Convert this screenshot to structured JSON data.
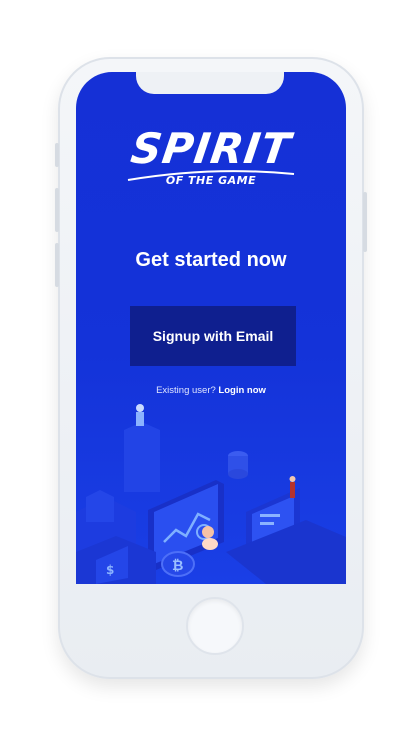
{
  "colors": {
    "screen_background": "#1433d9",
    "button_background": "#0f1f8f",
    "text": "#ffffff",
    "phone_body": "#eef1f5"
  },
  "logo": {
    "wordmark": "SPIRIT",
    "tagline": "OF THE GAME"
  },
  "main": {
    "headline": "Get started now",
    "signup_button_label": "Signup with Email",
    "existing_prompt": "Existing user?",
    "login_link": "Login now"
  },
  "icons": {
    "illustration": "isometric-finance-illustration-icon",
    "home_button": "home-button-icon"
  }
}
